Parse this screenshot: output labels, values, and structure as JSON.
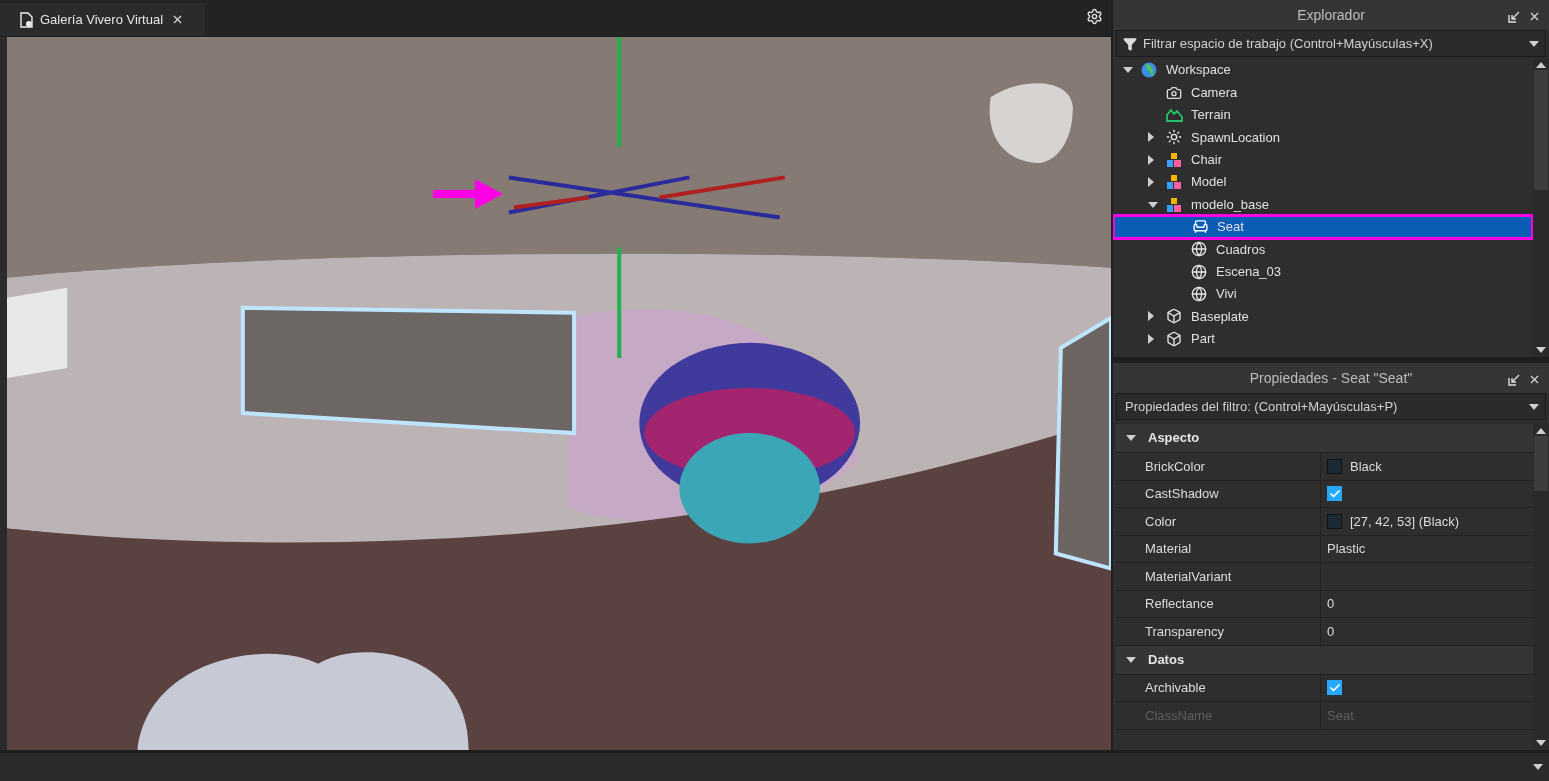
{
  "tab": {
    "title": "Galería Vivero Virtual"
  },
  "explorer": {
    "title": "Explorador",
    "filter_placeholder": "Filtrar espacio de trabajo (Control+Mayúsculas+X)",
    "tree": [
      {
        "label": "Workspace",
        "kind": "workspace",
        "expanded": true,
        "selected": false,
        "children": [
          {
            "label": "Camera",
            "kind": "camera",
            "selected": false
          },
          {
            "label": "Terrain",
            "kind": "terrain",
            "selected": false
          },
          {
            "label": "SpawnLocation",
            "kind": "spawn",
            "expanded": false,
            "selected": false
          },
          {
            "label": "Chair",
            "kind": "model",
            "expanded": false,
            "selected": false
          },
          {
            "label": "Model",
            "kind": "model",
            "expanded": false,
            "selected": false
          },
          {
            "label": "modelo_base",
            "kind": "model",
            "expanded": true,
            "selected": false,
            "children": [
              {
                "label": "Seat",
                "kind": "seat",
                "selected": true,
                "highlighted": true
              },
              {
                "label": "Cuadros",
                "kind": "mesh",
                "selected": false
              },
              {
                "label": "Escena_03",
                "kind": "mesh",
                "selected": false
              },
              {
                "label": "Vivi",
                "kind": "mesh",
                "selected": false
              }
            ]
          },
          {
            "label": "Baseplate",
            "kind": "part",
            "expanded": false,
            "selected": false
          },
          {
            "label": "Part",
            "kind": "part",
            "expanded": false,
            "selected": false
          }
        ]
      }
    ]
  },
  "properties": {
    "title": "Propiedades - Seat \"Seat\"",
    "filter_placeholder": "Propiedades del filtro: (Control+Mayúsculas+P)",
    "sections": [
      {
        "name": "Aspecto",
        "expanded": true,
        "rows": [
          {
            "name": "BrickColor",
            "kind": "color",
            "color": "#1b2a35",
            "value": "Black",
            "disabled": false
          },
          {
            "name": "CastShadow",
            "kind": "checkbox",
            "checked": true,
            "disabled": false
          },
          {
            "name": "Color",
            "kind": "color",
            "color": "#1b2a35",
            "value": "[27, 42, 53] (Black)",
            "disabled": false
          },
          {
            "name": "Material",
            "kind": "text",
            "value": "Plastic",
            "disabled": false
          },
          {
            "name": "MaterialVariant",
            "kind": "text",
            "disabled": false
          },
          {
            "name": "Reflectance",
            "kind": "text",
            "value": "0",
            "disabled": false
          },
          {
            "name": "Transparency",
            "kind": "text",
            "value": "0",
            "disabled": false
          }
        ]
      },
      {
        "name": "Datos",
        "expanded": true,
        "rows": [
          {
            "name": "Archivable",
            "kind": "checkbox",
            "checked": true,
            "disabled": false
          },
          {
            "name": "ClassName",
            "kind": "text",
            "value": "Seat",
            "disabled": true
          }
        ]
      }
    ]
  }
}
